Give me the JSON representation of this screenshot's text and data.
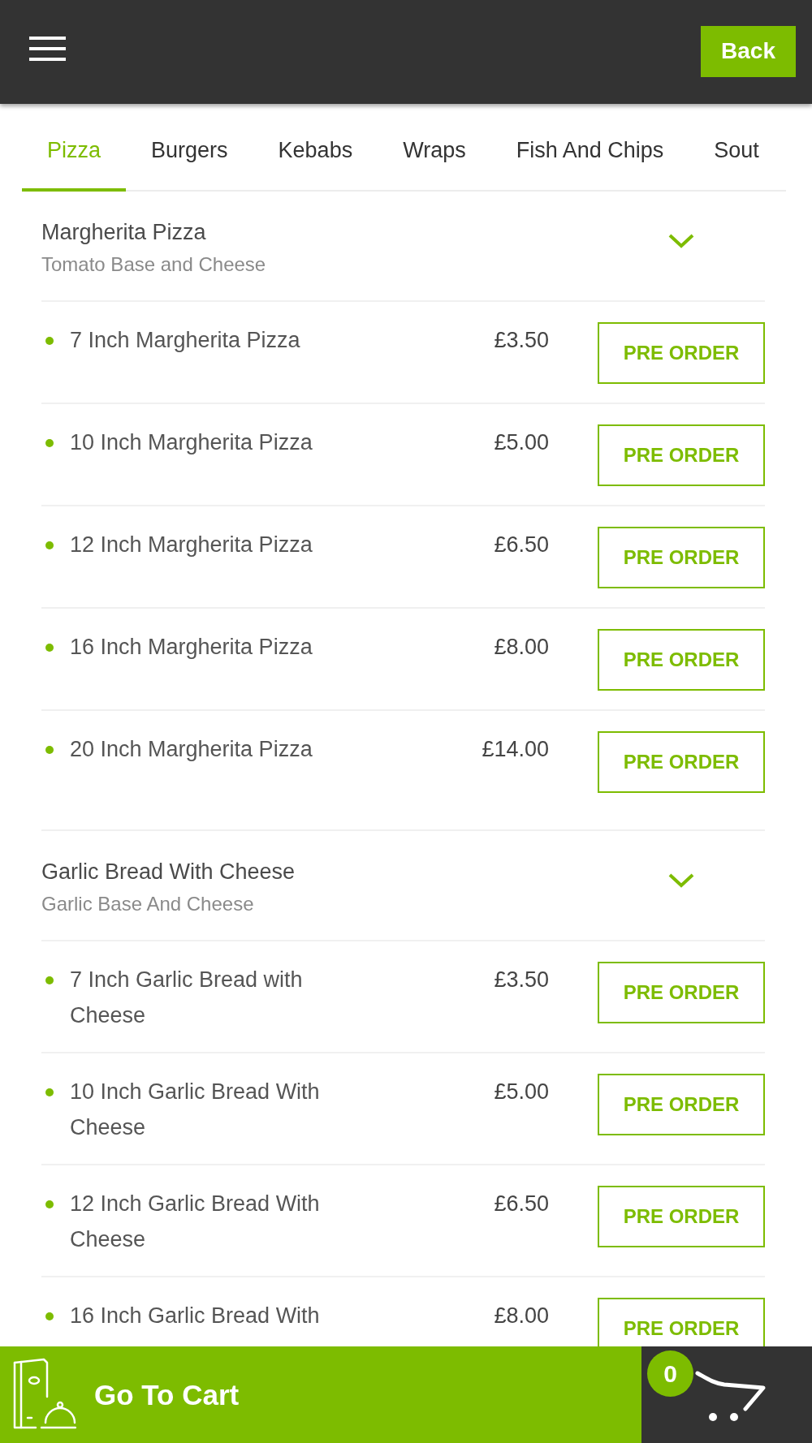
{
  "header": {
    "back_button": "Back"
  },
  "tabs": [
    {
      "label": "Pizza",
      "selected": true
    },
    {
      "label": "Burgers",
      "selected": false
    },
    {
      "label": "Kebabs",
      "selected": false
    },
    {
      "label": "Wraps",
      "selected": false
    },
    {
      "label": "Fish And Chips",
      "selected": false
    },
    {
      "label": "Sout",
      "selected": false
    }
  ],
  "sections": [
    {
      "title": "Margherita Pizza",
      "subtitle": "Tomato Base and Cheese",
      "items": [
        {
          "name": "7 Inch Margherita Pizza",
          "price": "£3.50",
          "button": "PRE ORDER"
        },
        {
          "name": "10 Inch Margherita Pizza",
          "price": "£5.00",
          "button": "PRE ORDER"
        },
        {
          "name": "12 Inch Margherita Pizza",
          "price": "£6.50",
          "button": "PRE ORDER"
        },
        {
          "name": "16 Inch Margherita Pizza",
          "price": "£8.00",
          "button": "PRE ORDER"
        },
        {
          "name": "20 Inch Margherita Pizza",
          "price": "£14.00",
          "button": "PRE ORDER"
        }
      ]
    },
    {
      "title": "Garlic Bread With Cheese",
      "subtitle": "Garlic Base And Cheese",
      "items": [
        {
          "name": "7 Inch Garlic Bread with Cheese",
          "price": "£3.50",
          "button": "PRE ORDER"
        },
        {
          "name": "10 Inch Garlic Bread With Cheese",
          "price": "£5.00",
          "button": "PRE ORDER"
        },
        {
          "name": "12 Inch Garlic Bread With Cheese",
          "price": "£6.50",
          "button": "PRE ORDER"
        },
        {
          "name": "16 Inch Garlic Bread With",
          "price": "£8.00",
          "button": "PRE ORDER"
        }
      ]
    }
  ],
  "cart": {
    "label": "Go To Cart",
    "count": "0"
  }
}
